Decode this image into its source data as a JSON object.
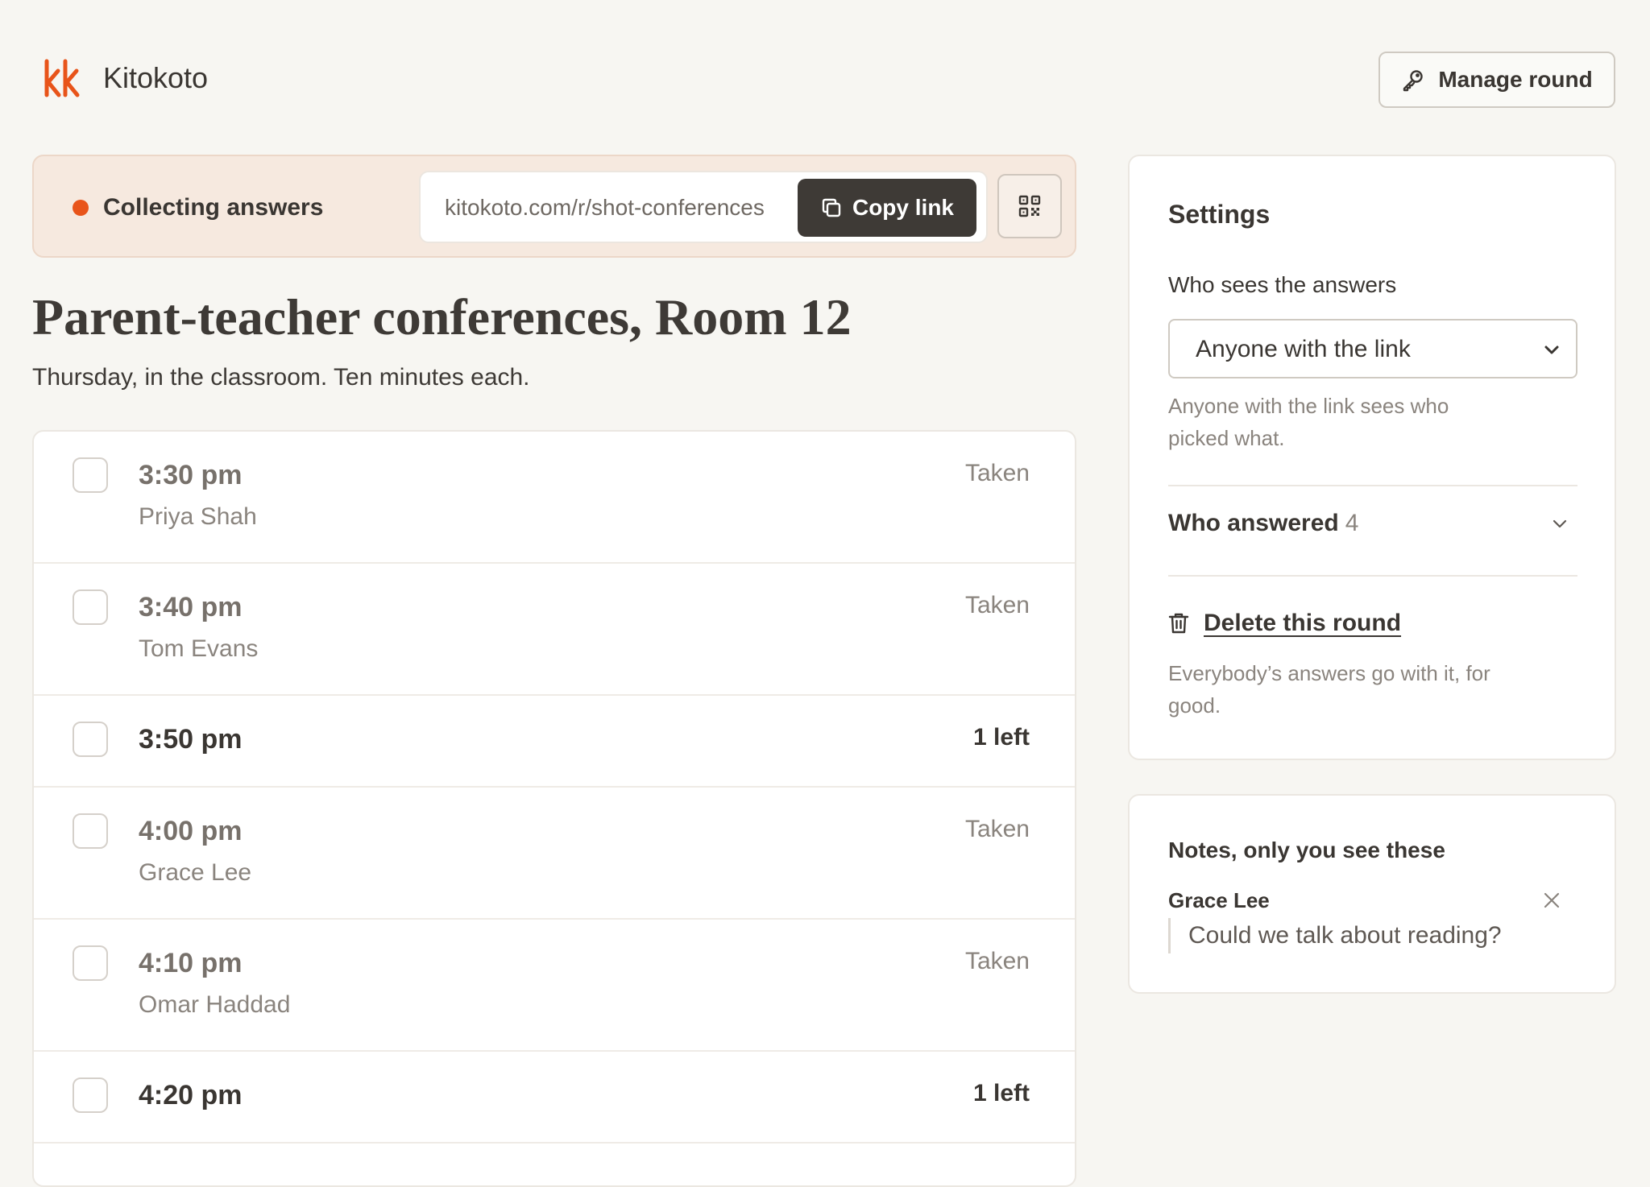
{
  "header": {
    "brand": "Kitokoto",
    "manage_label": "Manage round"
  },
  "status": {
    "label": "Collecting answers",
    "link": "kitokoto.com/r/shot-conferences",
    "copy_label": "Copy link"
  },
  "event": {
    "title": "Parent-teacher conferences, Room 12",
    "subtitle": "Thursday, in the classroom. Ten minutes each."
  },
  "slots": [
    {
      "time": "3:30 pm",
      "status": "Taken",
      "name": "Priya Shah"
    },
    {
      "time": "3:40 pm",
      "status": "Taken",
      "name": "Tom Evans"
    },
    {
      "time": "3:50 pm",
      "status": "1 left",
      "name": ""
    },
    {
      "time": "4:00 pm",
      "status": "Taken",
      "name": "Grace Lee"
    },
    {
      "time": "4:10 pm",
      "status": "Taken",
      "name": "Omar Haddad"
    },
    {
      "time": "4:20 pm",
      "status": "1 left",
      "name": ""
    }
  ],
  "settings": {
    "title": "Settings",
    "sees_label": "Who sees the answers",
    "sees_value": "Anyone with the link",
    "sees_help": "Anyone with the link sees who picked what.",
    "answered_label": "Who answered",
    "answered_count": "4",
    "delete_label": "Delete this round",
    "delete_help": "Everybody’s answers go with it, for good."
  },
  "notes": {
    "title": "Notes, only you see these",
    "items": [
      {
        "author": "Grace Lee",
        "text": "Could we talk about reading?"
      }
    ]
  },
  "colors": {
    "accent": "#e8541a",
    "background": "#f7f6f2",
    "status_bar": "#f6e9df",
    "dark_button": "#3e3a36"
  },
  "icons": {
    "logo": "kitokoto-logo",
    "manage": "key-icon",
    "copy": "copy-icon",
    "qr": "qr-code-icon",
    "select": "chevron-down-icon",
    "answered": "chevron-down-icon",
    "delete": "trash-icon",
    "note_close": "close-icon"
  }
}
